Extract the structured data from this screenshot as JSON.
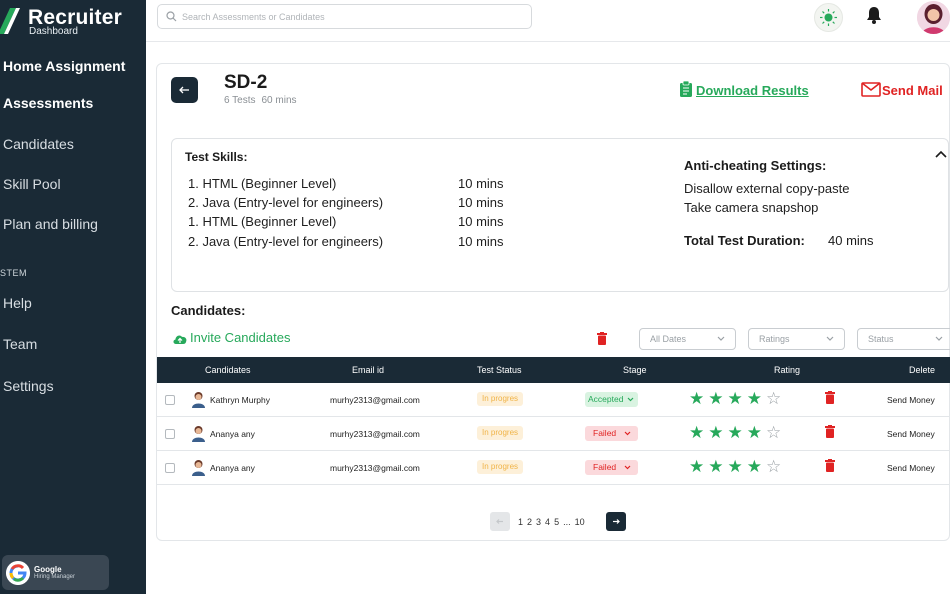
{
  "app": {
    "brand_title": "Recruiter",
    "brand_subtitle": "Dashboard"
  },
  "sidebar": {
    "items": [
      {
        "label": "Home Assignment"
      },
      {
        "label": "Assessments"
      },
      {
        "label": "Candidates"
      },
      {
        "label": "Skill Pool"
      },
      {
        "label": "Plan and billing"
      }
    ],
    "section_label": "STEM",
    "system_items": [
      {
        "label": "Help"
      },
      {
        "label": "Team"
      },
      {
        "label": "Settings"
      }
    ],
    "account": {
      "name": "Google",
      "role": "Hiring Manager"
    }
  },
  "topbar": {
    "search_placeholder": "Search Assessments or Candidates"
  },
  "assessment": {
    "title": "SD-2",
    "tests": "6 Tests",
    "duration": "60 mins",
    "download_label": "Download Results",
    "send_mail_label": "Send Mail"
  },
  "skills": {
    "heading": "Test Skills:",
    "rows": [
      {
        "label": "1. HTML (Beginner Level)",
        "duration": "10 mins"
      },
      {
        "label": "2. Java (Entry-level for engineers)",
        "duration": "10 mins"
      },
      {
        "label": "1. HTML (Beginner Level)",
        "duration": "10 mins"
      },
      {
        "label": "2. Java (Entry-level for engineers)",
        "duration": "10 mins"
      }
    ],
    "anti_cheat_heading": "Anti-cheating Settings:",
    "anti_cheat_items": [
      "Disallow external copy-paste",
      "Take camera snapshop"
    ],
    "total_label": "Total Test Duration:",
    "total_value": "40 mins"
  },
  "candidates": {
    "heading": "Candidates:",
    "invite_label": "Invite Candidates",
    "filters": [
      "All Dates",
      "Ratings",
      "Status"
    ],
    "columns": [
      "Candidates",
      "Email id",
      "Test Status",
      "Stage",
      "Rating",
      "Delete"
    ],
    "rows": [
      {
        "name": "Kathryn Murphy",
        "email": "murhy2313@gmail.com",
        "status": "In progres",
        "stage": "Accepted",
        "stage_type": "accept",
        "rating": 4,
        "rating_max": 5,
        "action": "Send Money"
      },
      {
        "name": "Ananya any",
        "email": "murhy2313@gmail.com",
        "status": "In progres",
        "stage": "Failed",
        "stage_type": "fail",
        "rating": 4,
        "rating_max": 5,
        "action": "Send Money"
      },
      {
        "name": "Ananya any",
        "email": "murhy2313@gmail.com",
        "status": "In progres",
        "stage": "Failed",
        "stage_type": "fail",
        "rating": 4,
        "rating_max": 5,
        "action": "Send Money"
      }
    ]
  },
  "pagination": {
    "pages": [
      "1",
      "2",
      "3",
      "4",
      "5",
      "...",
      "10"
    ]
  },
  "colors": {
    "sidebar": "#1a2a36",
    "accent_green": "#27a95b",
    "accent_red": "#e02323",
    "status_orange": "#f0b347"
  },
  "icons": [
    "logo-icon",
    "search-icon",
    "sun-icon",
    "bell-icon",
    "avatar",
    "back-arrow-icon",
    "clipboard-icon",
    "mail-icon",
    "chevron-up-icon",
    "cloud-upload-icon",
    "trash-icon",
    "chevron-down-icon",
    "star-icon",
    "arrow-left-icon",
    "arrow-right-icon",
    "google-icon"
  ]
}
